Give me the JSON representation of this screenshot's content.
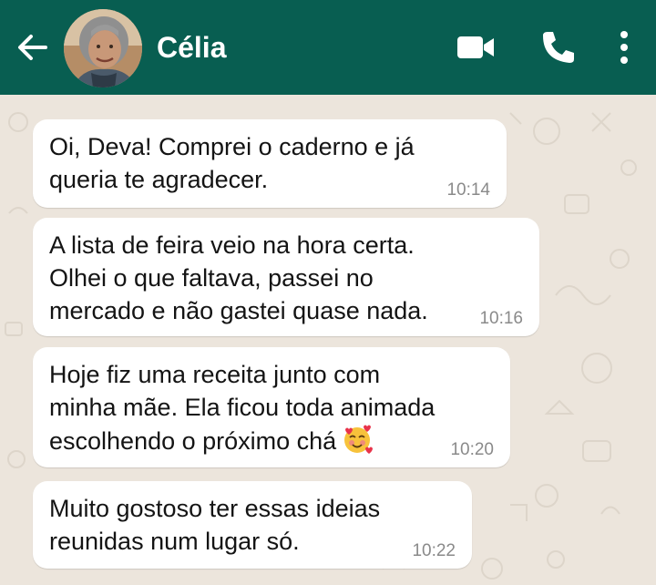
{
  "header": {
    "contact_name": "Célia",
    "background_color": "#085e51",
    "icons": [
      "back-arrow-icon",
      "video-call-icon",
      "phone-icon",
      "more-options-icon"
    ]
  },
  "chat": {
    "background_color": "#ece5dc",
    "messages": [
      {
        "text": "Oi, Deva! Comprei o caderno e já\nqueria te agradecer.",
        "time": "10:14"
      },
      {
        "text": "A lista de feira veio na hora certa.\nOlhei o que faltava, passei no\nmercado e não gastei quase nada.",
        "time": "10:16"
      },
      {
        "text": "Hoje fiz uma receita junto com\nminha mãe. Ela ficou toda animada\nescolhendo o próximo chá",
        "emoji": "smiling-face-with-hearts-icon",
        "time": "10:20"
      },
      {
        "text": "Muito gostoso ter essas ideias\nreunidas num lugar só.",
        "time": "10:22"
      }
    ]
  }
}
